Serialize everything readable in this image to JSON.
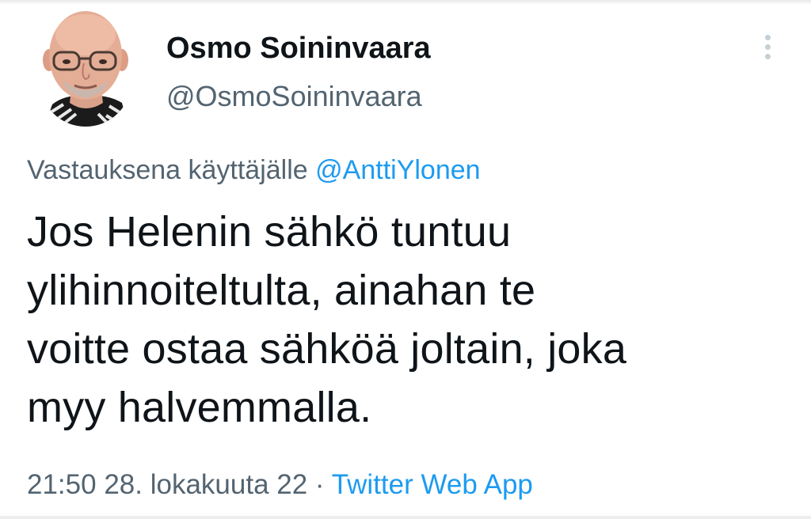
{
  "tweet": {
    "author": {
      "display_name": "Osmo Soininvaara",
      "handle": "@OsmoSoininvaara",
      "avatar_icon": "profile-photo"
    },
    "more_icon": "more-vertical-icon",
    "reply": {
      "prefix": "Vastauksena käyttäjälle ",
      "mention": "@AnttiYlonen"
    },
    "text_lines": [
      "Jos Helenin sähkö tuntuu",
      "ylihinnoiteltulta, ainahan te",
      "voitte ostaa sähköä joltain, joka",
      "myy halvemmalla."
    ],
    "meta": {
      "time": "21:50",
      "date": "28. lokakuuta 22",
      "separator": " · ",
      "source": "Twitter Web App"
    },
    "colors": {
      "text": "#0f1419",
      "secondary": "#536471",
      "link": "#1d9bf0"
    }
  }
}
